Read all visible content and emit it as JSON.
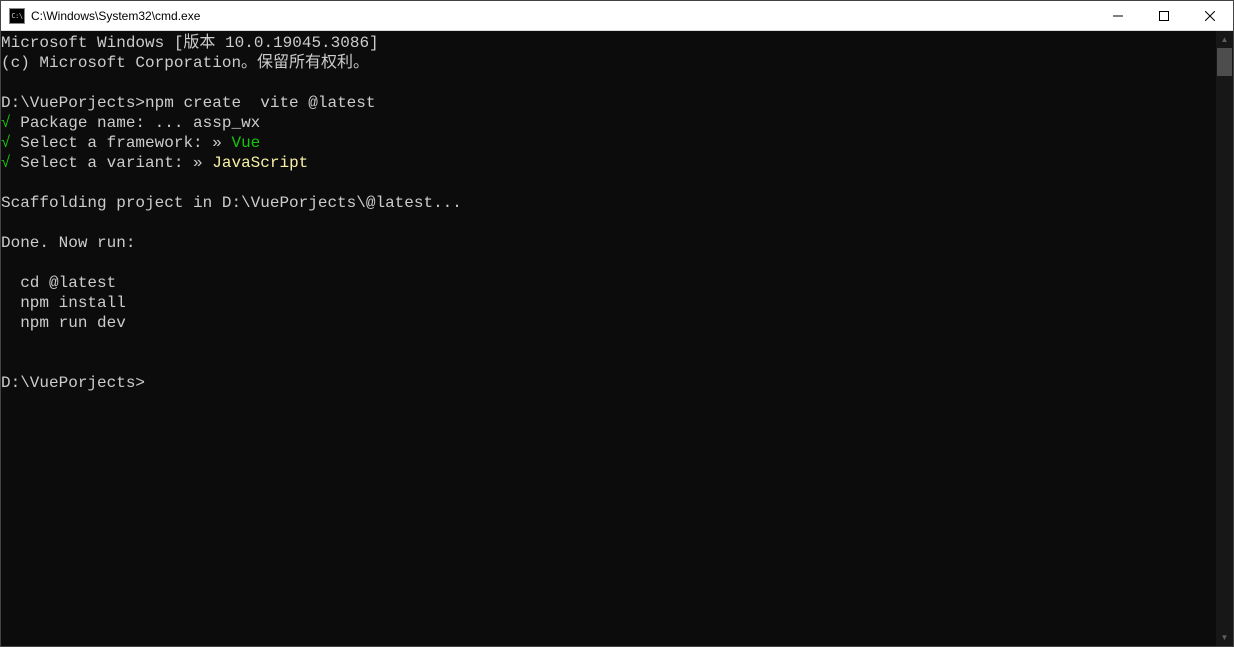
{
  "titlebar": {
    "icon_label": "C:\\",
    "title": "C:\\Windows\\System32\\cmd.exe"
  },
  "terminal": {
    "header1": "Microsoft Windows [版本 10.0.19045.3086]",
    "header2": "(c) Microsoft Corporation。保留所有权利。",
    "prompt1_path": "D:\\VuePorjects>",
    "prompt1_cmd": "npm create  vite @latest",
    "check": "√",
    "pkg_label": " Package name: ",
    "pkg_dots": "...",
    "pkg_value": " assp_wx",
    "fw_label": " Select a framework: ",
    "fw_arrow": "»",
    "fw_value": " Vue",
    "var_label": " Select a variant: ",
    "var_arrow": "»",
    "var_value": " JavaScript",
    "scaffold": "Scaffolding project in D:\\VuePorjects\\@latest...",
    "done": "Done. Now run:",
    "run1": "  cd @latest",
    "run2": "  npm install",
    "run3": "  npm run dev",
    "prompt2_path": "D:\\VuePorjects>"
  }
}
